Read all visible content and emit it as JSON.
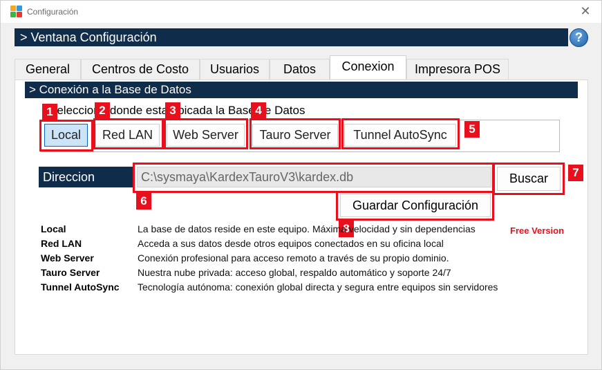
{
  "window": {
    "title": "Configuración",
    "close_glyph": "✕"
  },
  "header": {
    "title": "> Ventana Configuración",
    "help_glyph": "?"
  },
  "tabs": [
    {
      "label": "General",
      "active": false
    },
    {
      "label": "Centros de Costo",
      "active": false
    },
    {
      "label": "Usuarios",
      "active": false
    },
    {
      "label": "Datos",
      "active": false
    },
    {
      "label": "Conexion",
      "active": true
    },
    {
      "label": "Impresora POS",
      "active": false
    }
  ],
  "section": {
    "title": "> Conexión a la Base de Datos",
    "instruction": "Seleccione donde esta ubicada la Base de Datos"
  },
  "options": [
    {
      "label": "Local",
      "selected": true
    },
    {
      "label": "Red LAN",
      "selected": false
    },
    {
      "label": "Web Server",
      "selected": false
    },
    {
      "label": "Tauro Server",
      "selected": false
    },
    {
      "label": "Tunnel AutoSync",
      "selected": false
    }
  ],
  "direccion": {
    "label": "Direccion",
    "value": "C:\\sysmaya\\KardexTauroV3\\kardex.db"
  },
  "buttons": {
    "buscar": "Buscar",
    "guardar": "Guardar Configuración"
  },
  "annotations": [
    "1",
    "2",
    "3",
    "4",
    "5",
    "6",
    "7",
    "8"
  ],
  "descriptions": [
    {
      "name": "Local",
      "text": "La base de datos reside en este equipo. Máxima velocidad y sin dependencias"
    },
    {
      "name": "Red LAN",
      "text": "Acceda a sus datos desde otros equipos conectados en su oficina local"
    },
    {
      "name": "Web Server",
      "text": "Conexión profesional para acceso remoto a través de su propio dominio."
    },
    {
      "name": "Tauro Server",
      "text": "Nuestra nube privada: acceso global, respaldo automático y soporte 24/7"
    },
    {
      "name": "Tunnel AutoSync",
      "text": "Tecnología autónoma: conexión global directa y segura entre equipos sin servidores"
    }
  ],
  "free_version": "Free Version",
  "colors": {
    "navy_bar": "#0f2c4a",
    "highlight_red": "#e8101c",
    "selected_button": "#cce4f7"
  }
}
